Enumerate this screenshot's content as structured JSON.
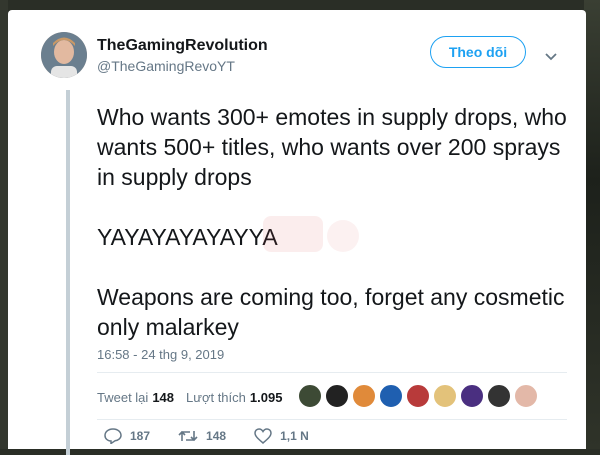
{
  "user": {
    "display_name": "TheGamingRevolution",
    "handle": "@TheGamingRevoYT"
  },
  "follow_label": "Theo dõi",
  "tweet": {
    "para1": "Who wants 300+ emotes in supply drops, who wants 500+ titles, who wants over 200 sprays in supply drops",
    "para2": "YAYAYAYAYAYYA",
    "para3": "Weapons are coming too, forget any cosmetic only malarkey"
  },
  "timestamp": "16:58 - 24 thg 9, 2019",
  "stats": {
    "retweets_label": "Tweet lại",
    "retweets": "148",
    "likes_label": "Lượt thích",
    "likes": "1.095"
  },
  "actions": {
    "replies": "187",
    "retweets": "148",
    "likes": "1,1 N"
  },
  "colors": {
    "accent": "#1da1f2",
    "text": "#14171a",
    "muted": "#657786"
  }
}
